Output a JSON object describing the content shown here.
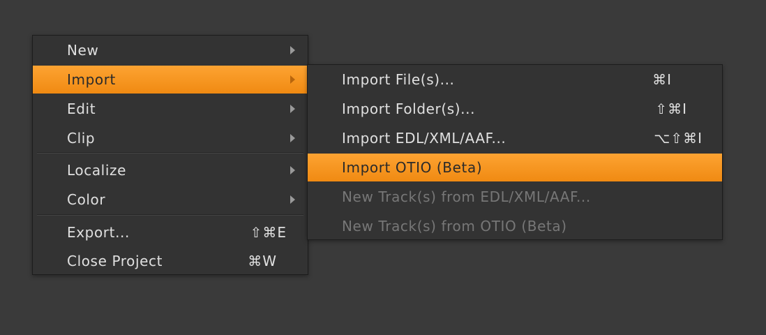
{
  "main_menu": {
    "items": [
      {
        "label": "New",
        "has_submenu": true
      },
      {
        "label": "Import",
        "has_submenu": true,
        "highlighted": true
      },
      {
        "label": "Edit",
        "has_submenu": true
      },
      {
        "label": "Clip",
        "has_submenu": true
      },
      {
        "label": "Localize",
        "has_submenu": true
      },
      {
        "label": "Color",
        "has_submenu": true
      },
      {
        "label": "Export...",
        "shortcut": "⇧⌘E"
      },
      {
        "label": "Close Project",
        "shortcut": "⌘W"
      }
    ]
  },
  "import_submenu": {
    "items": [
      {
        "label": "Import File(s)...",
        "shortcut": "⌘I"
      },
      {
        "label": "Import Folder(s)...",
        "shortcut": "⇧⌘I"
      },
      {
        "label": "Import EDL/XML/AAF...",
        "shortcut": "⌥⇧⌘I"
      },
      {
        "label": "Import OTIO (Beta)",
        "highlighted": true
      },
      {
        "label": "New Track(s) from EDL/XML/AAF...",
        "disabled": true
      },
      {
        "label": "New Track(s) from OTIO (Beta)",
        "disabled": true
      }
    ]
  },
  "colors": {
    "background": "#3a3a3a",
    "menu_bg": "#333333",
    "highlight": "#f7961f",
    "text": "#e0e0e0",
    "disabled_text": "#777777"
  }
}
